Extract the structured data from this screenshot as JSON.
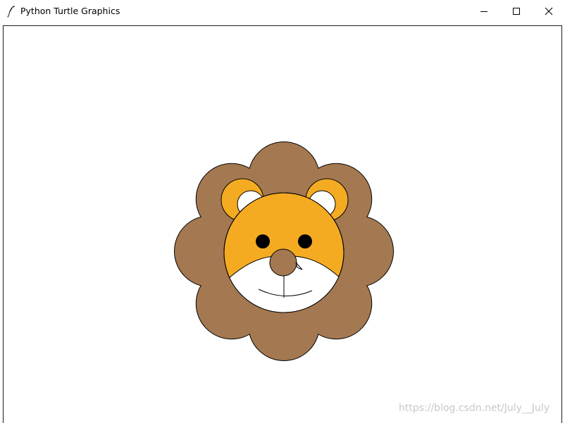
{
  "window": {
    "title": "Python Turtle Graphics",
    "controls": {
      "minimize_icon": "minimize-icon",
      "maximize_icon": "maximize-icon",
      "close_icon": "close-icon"
    },
    "app_icon": "feather-icon"
  },
  "drawing": {
    "subject": "lion",
    "colors": {
      "mane": "#a47850",
      "face": "#f4ab22",
      "ear_inner": "#ffffff",
      "eyes": "#000000",
      "nose": "#a47850",
      "muzzle": "#ffffff",
      "outline": "#000000",
      "background": "#ffffff"
    }
  },
  "watermark": {
    "text": "https://blog.csdn.net/July__July"
  }
}
